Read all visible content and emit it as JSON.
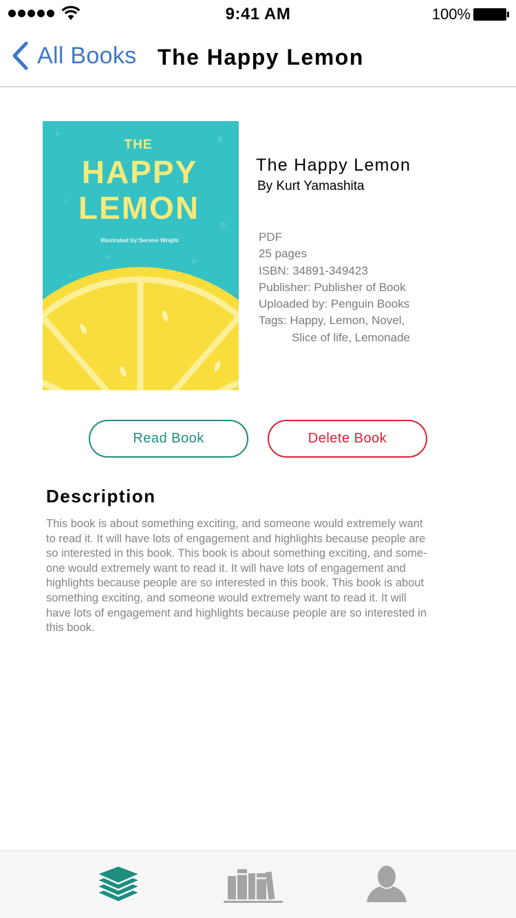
{
  "status_bar": {
    "time": "9:41 AM",
    "battery": "100%"
  },
  "nav": {
    "back_label": "All Books",
    "title": "The Happy Lemon"
  },
  "cover": {
    "line1": "THE",
    "line2": "HAPPY",
    "line3": "LEMON",
    "illustrator": "Illustrated by:Serene Wright",
    "colors": {
      "background": "#36c1c4",
      "lemon": "#f8dd3c",
      "lemon_pith": "#fbef97",
      "title_text": "#f4ea7c"
    }
  },
  "book": {
    "title": "The Happy Lemon",
    "author": "By Kurt Yamashita",
    "format": "PDF",
    "pages": "25 pages",
    "isbn": "ISBN: 34891-349423",
    "publisher": "Publisher: Publisher of Book",
    "uploaded_by": "Uploaded by: Penguin Books",
    "tags_line1": "Tags: Happy, Lemon, Novel,",
    "tags_line2": "Slice of life, Lemonade"
  },
  "actions": {
    "read_label": "Read Book",
    "delete_label": "Delete Book"
  },
  "description": {
    "heading": "Description",
    "lines": [
      "This book is about something exciting, and someone would extremely want",
      "to read it. It will have lots of engagement and highlights because people are",
      "so interested in this book. This book is about something exciting, and some-",
      "one would extremely want to read it. It will have lots of engagement and",
      "highlights because people are so interested in this book. This book is about",
      "something exciting, and someone would extremely want to read it. It will",
      "have lots of engagement and highlights because people are so interested in",
      "this book."
    ]
  },
  "tab_bar": {
    "tabs": [
      {
        "icon": "books-stack-icon",
        "active": true
      },
      {
        "icon": "bookshelf-icon",
        "active": false
      },
      {
        "icon": "profile-icon",
        "active": false
      }
    ],
    "colors": {
      "active": "#1d8e80",
      "inactive": "#a4a4a4"
    }
  },
  "colors": {
    "accent_blue": "#3d78c7",
    "read_green": "#1d8e80",
    "delete_red": "#e02032"
  }
}
